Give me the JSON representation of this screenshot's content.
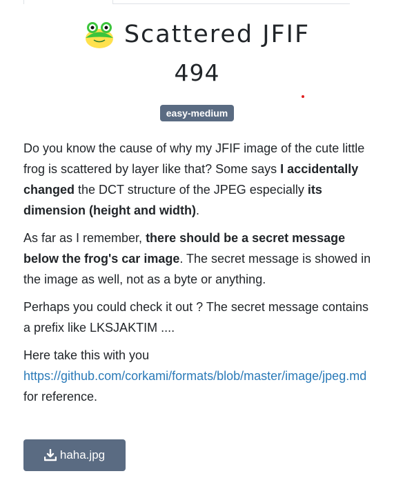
{
  "challenge": {
    "title": "Scattered JFIF",
    "points": "494",
    "difficulty": "easy-medium"
  },
  "description": {
    "p1": [
      "Do you know the cause of why my JFIF image of the cute little frog is scattered by layer like that? Some says ",
      "I accidentally changed",
      " the DCT structure of the JPEG especially ",
      "its dimension (height and width)",
      "."
    ],
    "p2": [
      "As far as I remember, ",
      "there should be a secret message below the frog's car image",
      ". The secret message is showed in the image as well, not as a byte or anything."
    ],
    "p3": "Perhaps you could check it out ? The secret message contains a prefix like LKSJAKTIM ....",
    "p4": {
      "intro": "Here take this with you",
      "link": "https://github.com/corkami/formats/blob/master/image/jpeg.md",
      "suffix": " for reference."
    }
  },
  "download": {
    "label": "haha.jpg",
    "icon": "download-icon"
  },
  "colors": {
    "badge": "#5a6b82",
    "link": "#2a7ab8",
    "frog_green": "#3cc43c",
    "frog_yellow": "#ffe14d"
  }
}
